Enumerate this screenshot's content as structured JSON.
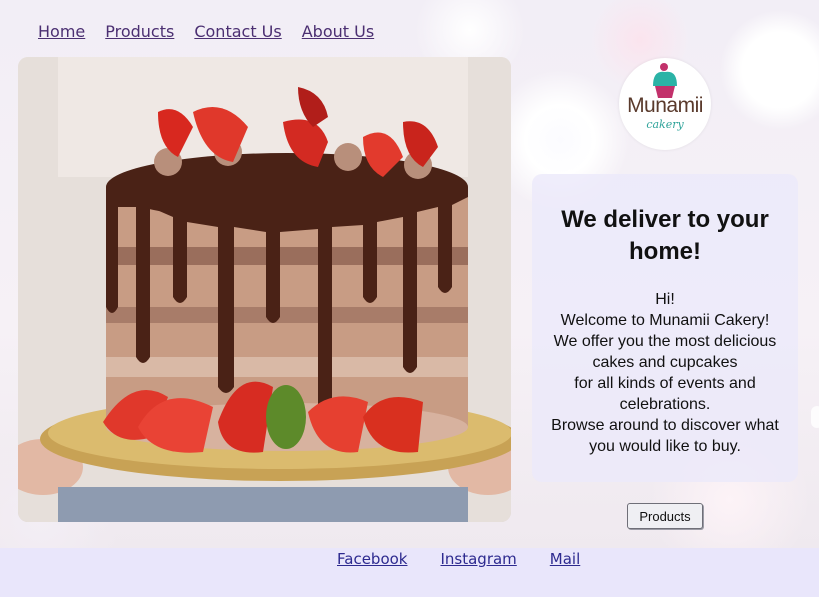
{
  "nav": {
    "items": [
      {
        "label": "Home"
      },
      {
        "label": "Products"
      },
      {
        "label": "Contact Us"
      },
      {
        "label": "About Us"
      }
    ]
  },
  "logo": {
    "name": "Munamii",
    "tagline": "cakery",
    "icon": "cupcake-icon"
  },
  "card": {
    "heading": "We deliver to your home!",
    "lines": [
      "Hi!",
      "Welcome to Munamii Cakery!",
      "We offer you the most delicious cakes and cupcakes",
      "for all kinds of events and celebrations.",
      "Browse around to discover what you would like to buy."
    ]
  },
  "cta": {
    "label": "Products"
  },
  "footer": {
    "links": [
      {
        "label": "Facebook"
      },
      {
        "label": "Instagram"
      },
      {
        "label": "Mail"
      }
    ]
  },
  "colors": {
    "nav_link": "#4b2f72",
    "footer_bg": "#e9e6fb",
    "card_bg": "#ece9fa",
    "footer_link": "#2d2a8f"
  }
}
